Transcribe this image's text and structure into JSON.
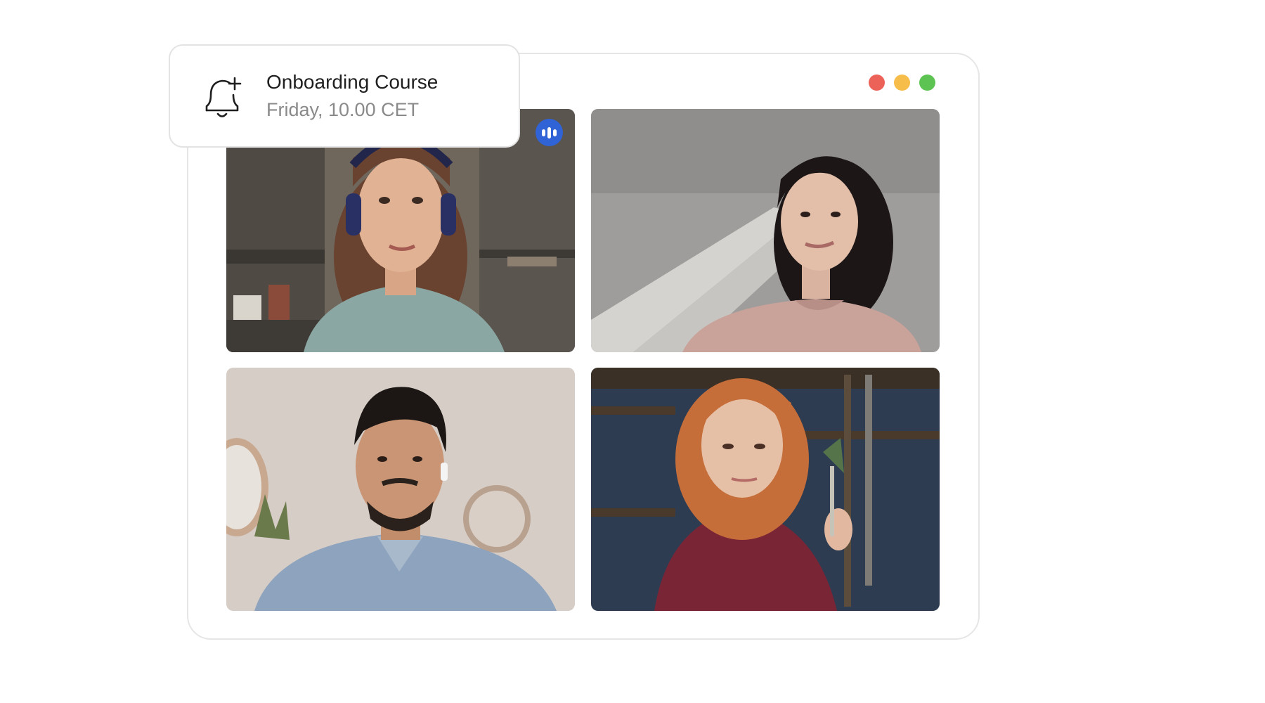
{
  "notification": {
    "icon": "bell-plus-icon",
    "title": "Onboarding Course",
    "subtitle": "Friday, 10.00 CET"
  },
  "window_controls": {
    "close_color": "#ec6259",
    "minimize_color": "#f6bd4a",
    "maximize_color": "#5dc353"
  },
  "speaking_indicator": {
    "icon": "audio-wave-icon",
    "color": "#2f63d6"
  },
  "participants": [
    {
      "position": "top-left",
      "speaking": true
    },
    {
      "position": "top-right",
      "speaking": false
    },
    {
      "position": "bottom-left",
      "speaking": false
    },
    {
      "position": "bottom-right",
      "speaking": false
    }
  ]
}
